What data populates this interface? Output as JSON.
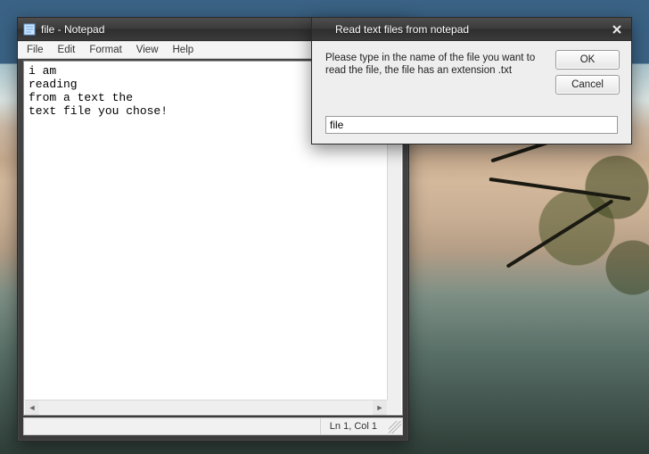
{
  "notepad": {
    "title": "file - Notepad",
    "menu": {
      "file": "File",
      "edit": "Edit",
      "format": "Format",
      "view": "View",
      "help": "Help"
    },
    "content": "i am\nreading\nfrom a text the\ntext file you chose!",
    "status": "Ln 1, Col 1"
  },
  "dialog": {
    "title": "Read text files from notepad",
    "message": "Please type in the name of the file you want to read the file, the file has an extension .txt",
    "ok_label": "OK",
    "cancel_label": "Cancel",
    "input_value": "file"
  }
}
